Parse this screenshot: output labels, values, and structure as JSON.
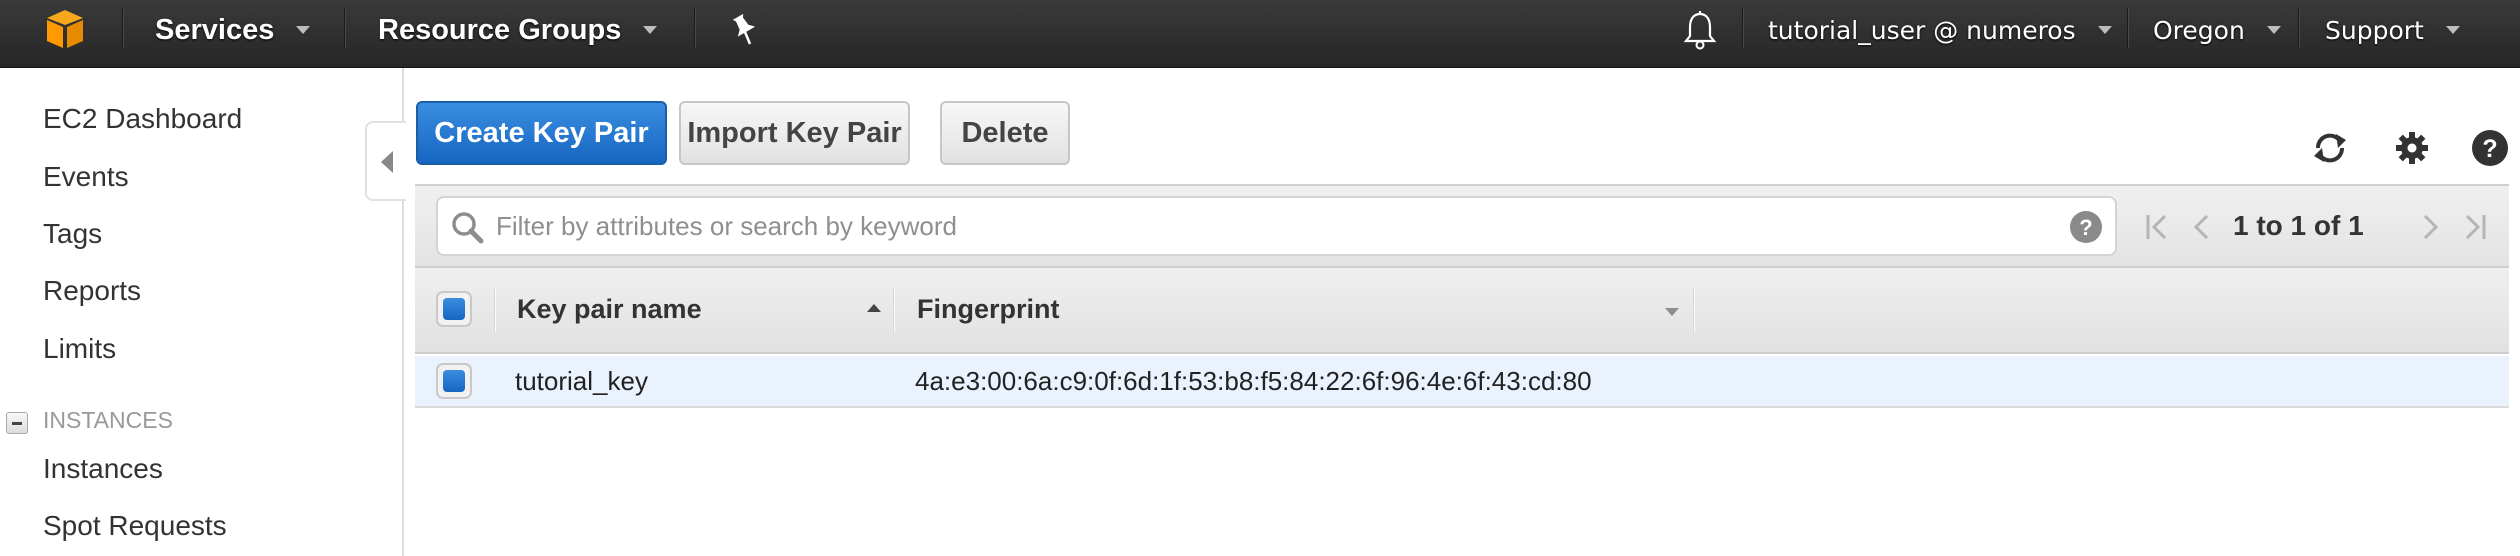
{
  "topnav": {
    "logo": "aws-cube-logo",
    "services_label": "Services",
    "resource_groups_label": "Resource Groups",
    "pin_icon": "pushpin-icon",
    "bell_icon": "bell-icon",
    "account_label": "tutorial_user @ numeros",
    "region_label": "Oregon",
    "support_label": "Support",
    "logo_color": "#F90"
  },
  "sidebar": {
    "items": [
      {
        "label": "EC2 Dashboard"
      },
      {
        "label": "Events"
      },
      {
        "label": "Tags"
      },
      {
        "label": "Reports"
      },
      {
        "label": "Limits"
      }
    ],
    "sections": [
      {
        "title": "INSTANCES",
        "items": [
          {
            "label": "Instances"
          },
          {
            "label": "Spot Requests"
          }
        ]
      }
    ]
  },
  "toolbar": {
    "create_label": "Create Key Pair",
    "import_label": "Import Key Pair",
    "delete_label": "Delete",
    "refresh_icon": "refresh-icon",
    "settings_icon": "gear-icon",
    "help_icon": "help-icon",
    "accent": "#1f73cf"
  },
  "filter": {
    "placeholder": "Filter by attributes or search by keyword",
    "value": ""
  },
  "pagination": {
    "text": "1 to 1 of 1"
  },
  "table": {
    "columns": [
      {
        "label": "Key pair name",
        "sort": "ascending"
      },
      {
        "label": "Fingerprint",
        "sort": "none"
      }
    ],
    "rows": [
      {
        "selected": true,
        "name": "tutorial_key",
        "fingerprint": "4a:e3:00:6a:c9:0f:6d:1f:53:b8:f5:84:22:6f:96:4e:6f:43:cd:80"
      }
    ]
  }
}
